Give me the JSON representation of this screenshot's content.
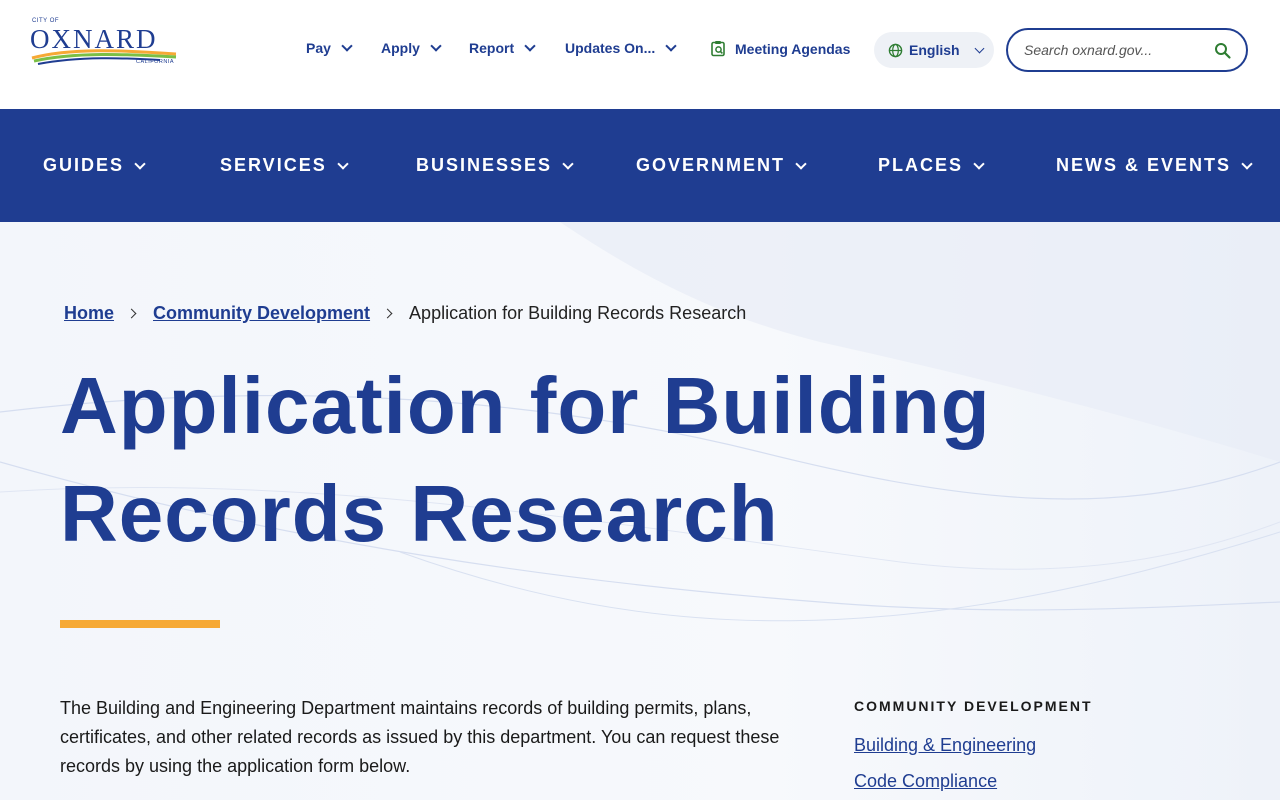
{
  "logo": {
    "city_of": "CITY OF",
    "name": "OXNARD",
    "state": "CALIFORNIA"
  },
  "utility_nav": {
    "items": [
      {
        "label": "Pay"
      },
      {
        "label": "Apply"
      },
      {
        "label": "Report"
      },
      {
        "label": "Updates On..."
      },
      {
        "label": "Meeting Agendas"
      }
    ],
    "language": "English",
    "search_placeholder": "Search oxnard.gov..."
  },
  "main_nav": {
    "items": [
      {
        "label": "GUIDES"
      },
      {
        "label": "SERVICES"
      },
      {
        "label": "BUSINESSES"
      },
      {
        "label": "GOVERNMENT"
      },
      {
        "label": "PLACES"
      },
      {
        "label": "NEWS & EVENTS"
      }
    ]
  },
  "breadcrumb": {
    "home": "Home",
    "parent": "Community Development",
    "current": "Application for Building Records Research"
  },
  "page": {
    "title": "Application for Building Records Research",
    "intro": "The Building and Engineering Department maintains records of building permits, plans, certificates, and other related records as issued by this department. You can request these records by using the application form below."
  },
  "sidebar": {
    "heading": "COMMUNITY DEVELOPMENT",
    "links": [
      {
        "label": "Building & Engineering"
      },
      {
        "label": "Code Compliance"
      }
    ]
  },
  "colors": {
    "brand_blue": "#1f3d91",
    "accent_orange": "#f6a935",
    "meeting_icon_green": "#2e7d32"
  }
}
